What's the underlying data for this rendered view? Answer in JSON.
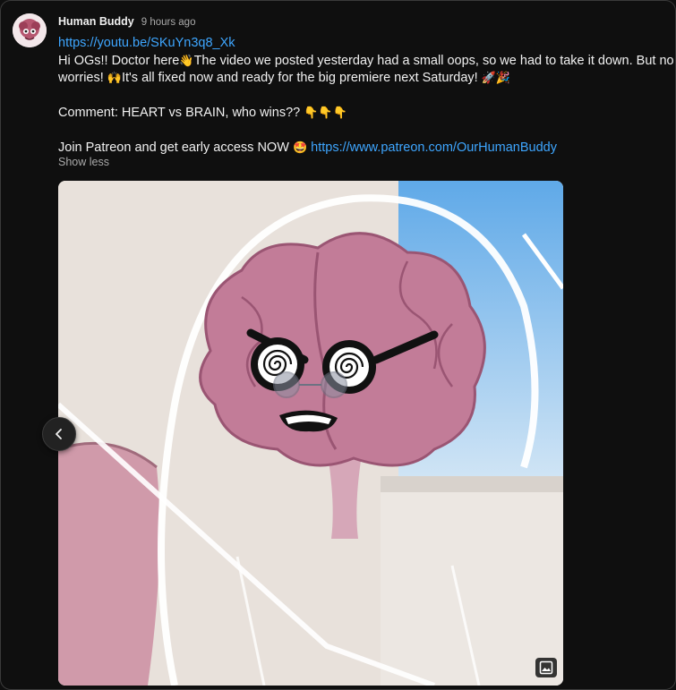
{
  "post": {
    "author": "Human Buddy",
    "time": "9 hours ago",
    "link_youtube": "https://youtu.be/SKuYn3q8_Xk",
    "line1_a": "Hi OGs!! Doctor here",
    "line1_emoji": "👋",
    "line1_b": "The video we posted yesterday had a small oops, so we had to take it down. But no",
    "line2_a": "worries! ",
    "line2_emoji": "🙌",
    "line2_b": "It's all fixed now and ready for the big premiere next Saturday! ",
    "line2_emoji2": "🚀🎉",
    "comment_text": "Comment: HEART vs BRAIN, who wins?? ",
    "comment_emoji": "👇👇👇",
    "patreon_text": "Join Patreon and get early access NOW ",
    "patreon_emoji": "🤩",
    "patreon_link": "https://www.patreon.com/OurHumanBuddy",
    "show_less": "Show less"
  },
  "icons": {
    "avatar": "channel-avatar",
    "prev": "chevron-left-icon",
    "media_badge": "image-icon"
  },
  "colors": {
    "background": "#0f0f0f",
    "link": "#3ea6ff",
    "secondary_text": "#aaaaaa",
    "brain": "#c27c98"
  }
}
